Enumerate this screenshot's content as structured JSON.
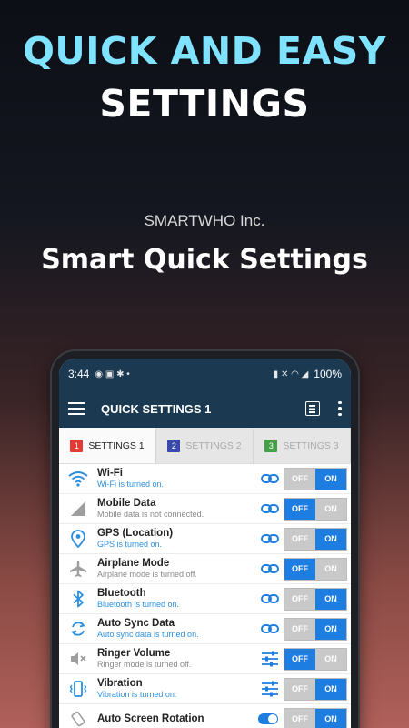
{
  "promo": {
    "headline1": "QUICK AND EASY",
    "headline2": "SETTINGS",
    "company": "SMARTWHO Inc.",
    "app_name": "Smart Quick Settings"
  },
  "status_bar": {
    "time": "3:44",
    "battery": "100%"
  },
  "app_bar": {
    "title": "QUICK SETTINGS 1"
  },
  "tabs": [
    {
      "num": "1",
      "label": "SETTINGS 1",
      "color": "#e53935"
    },
    {
      "num": "2",
      "label": "SETTINGS 2",
      "color": "#3949ab"
    },
    {
      "num": "3",
      "label": "SETTINGS 3",
      "color": "#43a047"
    }
  ],
  "toggle_labels": {
    "off": "OFF",
    "on": "ON"
  },
  "settings": [
    {
      "title": "Wi-Fi",
      "status": "Wi-Fi is turned on.",
      "on": true,
      "icon": "wifi-icon"
    },
    {
      "title": "Mobile Data",
      "status": "Mobile data is not connected.",
      "on": false,
      "icon": "signal-icon"
    },
    {
      "title": "GPS (Location)",
      "status": "GPS is turned on.",
      "on": true,
      "icon": "location-pin-icon"
    },
    {
      "title": "Airplane Mode",
      "status": "Airplane mode is turned off.",
      "on": false,
      "icon": "airplane-icon"
    },
    {
      "title": "Bluetooth",
      "status": "Bluetooth is turned on.",
      "on": true,
      "icon": "bluetooth-icon"
    },
    {
      "title": "Auto Sync Data",
      "status": "Auto sync data is turned on.",
      "on": true,
      "icon": "sync-icon"
    },
    {
      "title": "Ringer Volume",
      "status": "Ringer mode is turned off.",
      "on": false,
      "icon": "speaker-mute-icon"
    },
    {
      "title": "Vibration",
      "status": "Vibration is turned on.",
      "on": true,
      "icon": "vibrate-icon"
    },
    {
      "title": "Auto Screen Rotation",
      "status": "",
      "on": true,
      "icon": "rotation-icon"
    }
  ]
}
